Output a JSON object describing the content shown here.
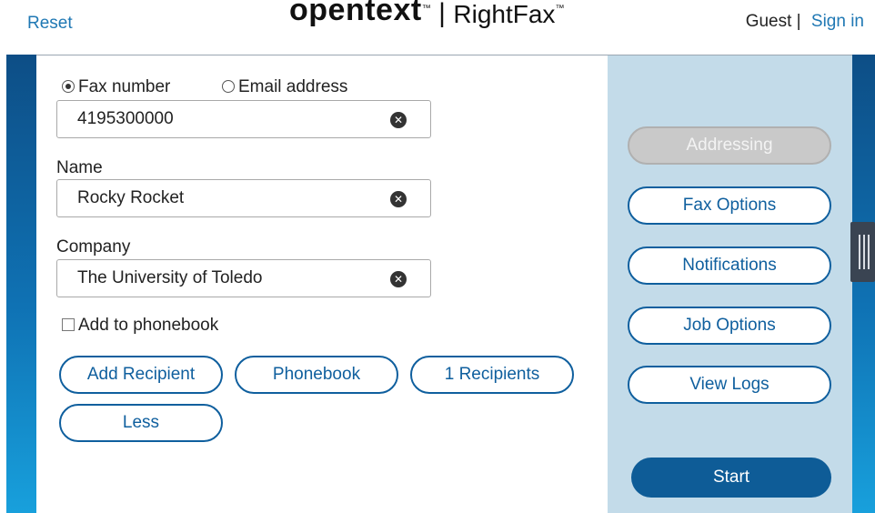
{
  "header": {
    "reset_label": "Reset",
    "logo_brand": "opentext",
    "logo_tm": "™",
    "logo_separator": "|",
    "logo_product": "RightFax",
    "product_tm": "™",
    "guest_label": "Guest |",
    "signin_label": "Sign in"
  },
  "form": {
    "fax_option": "Fax number",
    "email_option": "Email address",
    "selected_option": "Fax number",
    "fax_number_value": "4195300000",
    "name_label": "Name",
    "name_value": "Rocky Rocket",
    "company_label": "Company",
    "company_value": "The University of Toledo",
    "clear_glyph": "✕",
    "phonebook_label": "Add to phonebook",
    "phonebook_checked": false,
    "add_recipient_label": "Add Recipient",
    "phonebook_button_label": "Phonebook",
    "recipients_label": "1 Recipients",
    "less_label": "Less"
  },
  "side_menu": {
    "addressing_label": "Addressing",
    "fax_options_label": "Fax Options",
    "notifications_label": "Notifications",
    "job_options_label": "Job Options",
    "view_logs_label": "View Logs",
    "start_label": "Start"
  },
  "colors": {
    "accent": "#0f5f9e",
    "link": "#1f78b4",
    "side_panel": "#c3dbe9",
    "start_button": "#0e5c97"
  }
}
